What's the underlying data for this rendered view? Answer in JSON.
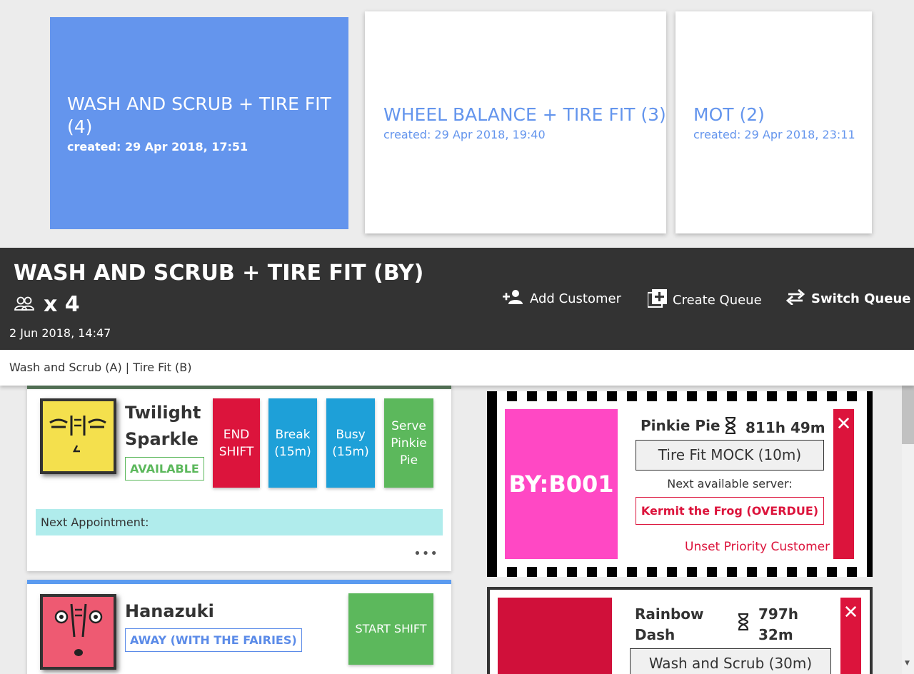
{
  "queues": [
    {
      "title": "WASH AND SCRUB + TIRE FIT (4)",
      "created": "created: 29 Apr 2018, 17:51"
    },
    {
      "title": "WHEEL BALANCE + TIRE FIT (3)",
      "created": "created: 29 Apr 2018, 19:40"
    },
    {
      "title": "MOT (2)",
      "created": "created: 29 Apr 2018, 23:11"
    }
  ],
  "header": {
    "title": "WASH AND SCRUB + TIRE FIT (BY)",
    "count": "x 4",
    "date": "2 Jun 2018, 14:47",
    "add_customer": "Add Customer",
    "create_queue": "Create Queue",
    "switch_queue": "Switch Queue"
  },
  "services_line": "Wash and Scrub (A) | Tire Fit (B)",
  "servers": [
    {
      "name_line1": "Twilight",
      "name_line2": "Sparkle",
      "status": "AVAILABLE",
      "buttons": {
        "end_shift": "END SHIFT",
        "break": "Break (15m)",
        "busy": "Busy (15m)",
        "serve": "Serve Pinkie Pie"
      },
      "next_appointment": "Next Appointment:",
      "more": "•••"
    },
    {
      "name": "Hanazuki",
      "status": "AWAY (WITH THE FAIRIES)",
      "start_shift": "START SHIFT"
    }
  ],
  "customers": [
    {
      "ticket": "BY:B001",
      "name": "Pinkie Pie",
      "wait": "811h 49m",
      "service": "Tire Fit MOCK (10m)",
      "next_label": "Next available server:",
      "next_server": "Kermit the Frog (OVERDUE)",
      "unset": "Unset Priority Customer",
      "close": "✕"
    },
    {
      "name_line1": "Rainbow",
      "name_line2": "Dash",
      "wait_line1": "797h",
      "wait_line2": "32m",
      "service": "Wash and Scrub (30m)",
      "close": "✕"
    }
  ],
  "colors": {
    "accent": "#6495ed",
    "header_bg": "#333333",
    "danger": "#dc143c",
    "info": "#1ea0d8",
    "success": "#5cb85c",
    "ticket_pink": "#ff48c4"
  }
}
